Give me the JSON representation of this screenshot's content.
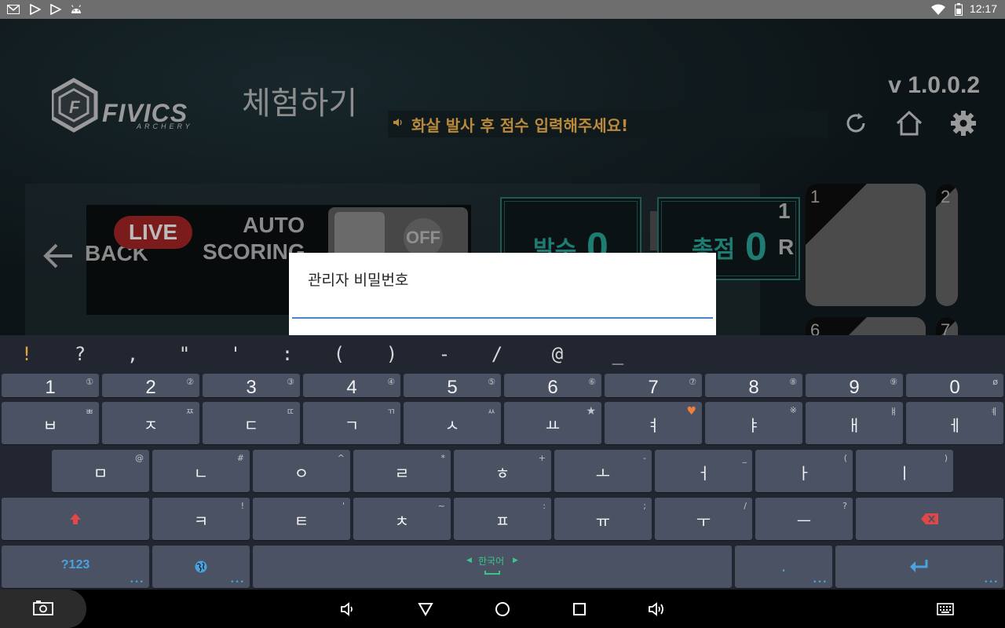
{
  "status_bar": {
    "time": "12:17",
    "left_icons": [
      "gmail-icon",
      "play-store-icon",
      "play-store-icon",
      "android-icon"
    ],
    "right_icons": [
      "wifi-icon",
      "battery-icon"
    ]
  },
  "app": {
    "brand": "FIVICS",
    "brand_sub": "ARCHERY",
    "page_title": "체험하기",
    "notice": "화살 발사 후 점수 입력해주세요!",
    "version": "v 1.0.0.2",
    "top_icons": [
      "refresh-icon",
      "home-icon",
      "settings-icon"
    ],
    "back_label": "BACK",
    "live_label": "LIVE",
    "auto_scoring_line1": "AUTO",
    "auto_scoring_line2": "SCORING",
    "toggle_label": "OFF",
    "shots_label": "발수",
    "shots_value": "0",
    "plus_label": "+",
    "total_label": "총점",
    "total_value": "0",
    "round_number": "1",
    "round_letter": "R",
    "tiles": [
      "1",
      "2",
      "6",
      "7"
    ]
  },
  "dialog": {
    "title": "관리자 비밀번호",
    "input_value": ""
  },
  "keyboard": {
    "symbols": [
      "!",
      "?",
      ",",
      "\"",
      "'",
      ":",
      "(",
      ")",
      "-",
      "/",
      "@",
      "_"
    ],
    "numbers": [
      {
        "main": "1",
        "sub": "①"
      },
      {
        "main": "2",
        "sub": "②"
      },
      {
        "main": "3",
        "sub": "③"
      },
      {
        "main": "4",
        "sub": "④"
      },
      {
        "main": "5",
        "sub": "⑤"
      },
      {
        "main": "6",
        "sub": "⑥"
      },
      {
        "main": "7",
        "sub": "⑦"
      },
      {
        "main": "8",
        "sub": "⑧"
      },
      {
        "main": "9",
        "sub": "⑨"
      },
      {
        "main": "0",
        "sub": "ø"
      }
    ],
    "row1": [
      {
        "main": "ㅂ",
        "sub": "ㅃ"
      },
      {
        "main": "ㅈ",
        "sub": "ㅉ"
      },
      {
        "main": "ㄷ",
        "sub": "ㄸ"
      },
      {
        "main": "ㄱ",
        "sub": "ㄲ"
      },
      {
        "main": "ㅅ",
        "sub": "ㅆ"
      },
      {
        "main": "ㅛ",
        "sub": "★"
      },
      {
        "main": "ㅕ",
        "sub": "♥"
      },
      {
        "main": "ㅑ",
        "sub": "※"
      },
      {
        "main": "ㅐ",
        "sub": "ㅒ"
      },
      {
        "main": "ㅔ",
        "sub": "ㅖ"
      }
    ],
    "row2": [
      {
        "main": "ㅁ",
        "sub": "@"
      },
      {
        "main": "ㄴ",
        "sub": "#"
      },
      {
        "main": "ㅇ",
        "sub": "^"
      },
      {
        "main": "ㄹ",
        "sub": "*"
      },
      {
        "main": "ㅎ",
        "sub": "+"
      },
      {
        "main": "ㅗ",
        "sub": "-"
      },
      {
        "main": "ㅓ",
        "sub": "_"
      },
      {
        "main": "ㅏ",
        "sub": "("
      },
      {
        "main": "ㅣ",
        "sub": ")"
      }
    ],
    "row3": [
      {
        "main": "ㅋ",
        "sub": "!"
      },
      {
        "main": "ㅌ",
        "sub": "'"
      },
      {
        "main": "ㅊ",
        "sub": "~"
      },
      {
        "main": "ㅍ",
        "sub": ":"
      },
      {
        "main": "ㅠ",
        "sub": ";"
      },
      {
        "main": "ㅜ",
        "sub": "/"
      },
      {
        "main": "ㅡ",
        "sub": "?"
      }
    ],
    "mode_label": "?123",
    "language_label": "한국어",
    "period_label": ".",
    "accent_color": "#4aa3df",
    "heart_color": "#f07f3c",
    "shift_color": "#e04848"
  },
  "nav_bar": {
    "icons": [
      "screenshot-icon",
      "volume-down-icon",
      "back-icon",
      "home-icon",
      "recents-icon",
      "volume-up-icon",
      "keyboard-icon"
    ]
  }
}
